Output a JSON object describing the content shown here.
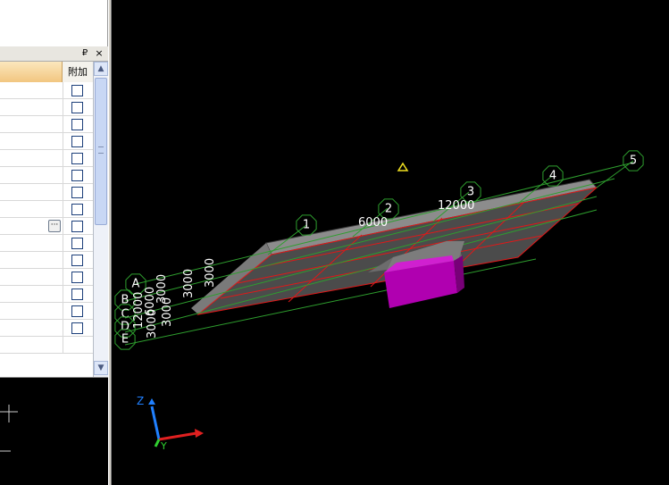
{
  "panel": {
    "pin_glyph": "₽",
    "close_glyph": "×",
    "extra_column_header": "附加",
    "ellipsis_label": "···",
    "row_count": 16,
    "ellipsis_row_index": 8,
    "scroll_up_glyph": "▲",
    "scroll_down_glyph": "▼"
  },
  "viewport": {
    "column_axes": [
      "1",
      "2",
      "3",
      "4",
      "5"
    ],
    "row_axes": [
      "A",
      "B",
      "C",
      "D",
      "E"
    ],
    "column_dimensions": [
      "6000",
      "12000"
    ],
    "row_dimensions": [
      "12000",
      "6000",
      "3000",
      "3000",
      "3000",
      "3000",
      "3000"
    ],
    "axis_triad": {
      "z": "Z",
      "y": "Y"
    },
    "colors": {
      "background": "#000000",
      "grid": "#2e9e2e",
      "beam": "#e02020",
      "slab_top": "#5a5a5a",
      "column": "#b000b0"
    }
  }
}
